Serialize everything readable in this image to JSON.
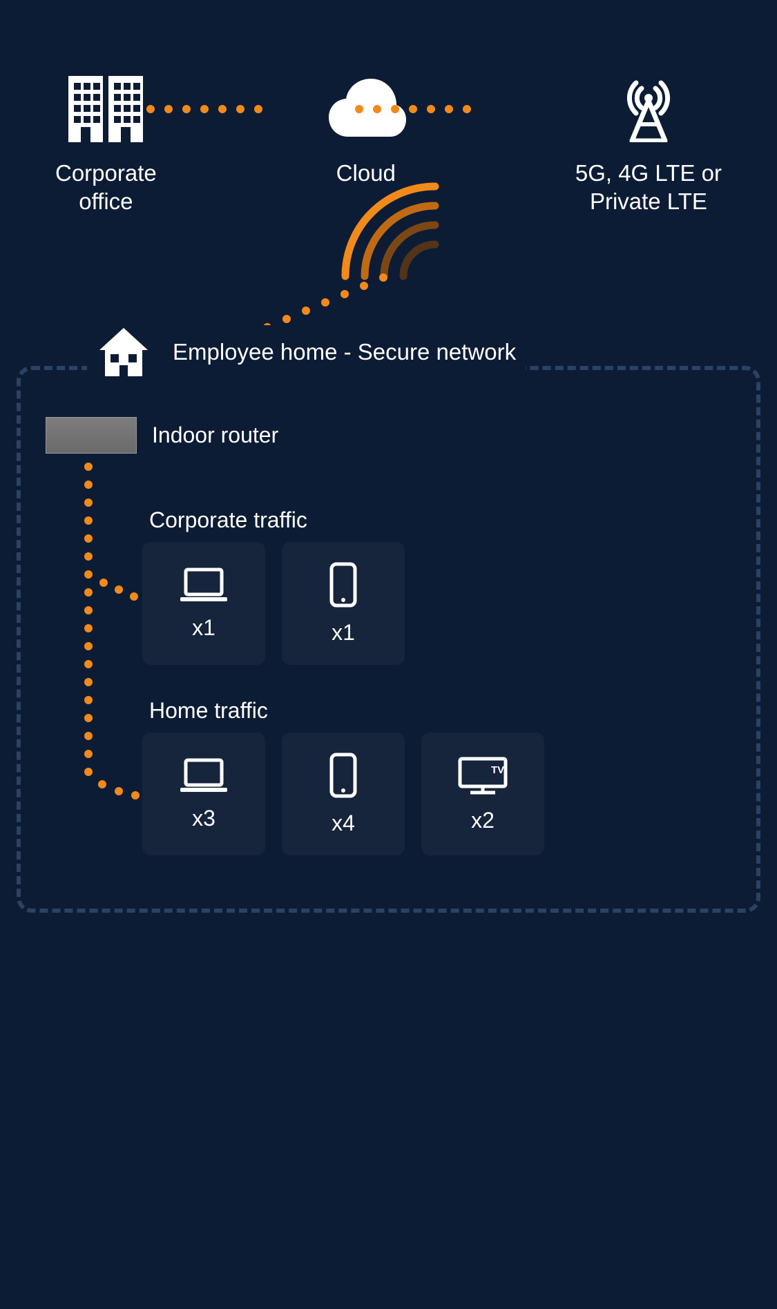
{
  "top": {
    "corporate_office": "Corporate\noffice",
    "cloud": "Cloud",
    "cell": "5G, 4G LTE or\nPrivate LTE"
  },
  "home_header": "Employee home - Secure network",
  "router_label": "Indoor router",
  "sections": {
    "corporate": {
      "title": "Corporate traffic",
      "devices": [
        {
          "icon": "laptop",
          "count": "x1"
        },
        {
          "icon": "phone",
          "count": "x1"
        }
      ]
    },
    "home": {
      "title": "Home traffic",
      "devices": [
        {
          "icon": "laptop",
          "count": "x3"
        },
        {
          "icon": "phone",
          "count": "x4"
        },
        {
          "icon": "tv",
          "count": "x2"
        }
      ]
    }
  },
  "colors": {
    "accent": "#f28a1a",
    "card": "#16243c",
    "dash": "#2c4261"
  }
}
